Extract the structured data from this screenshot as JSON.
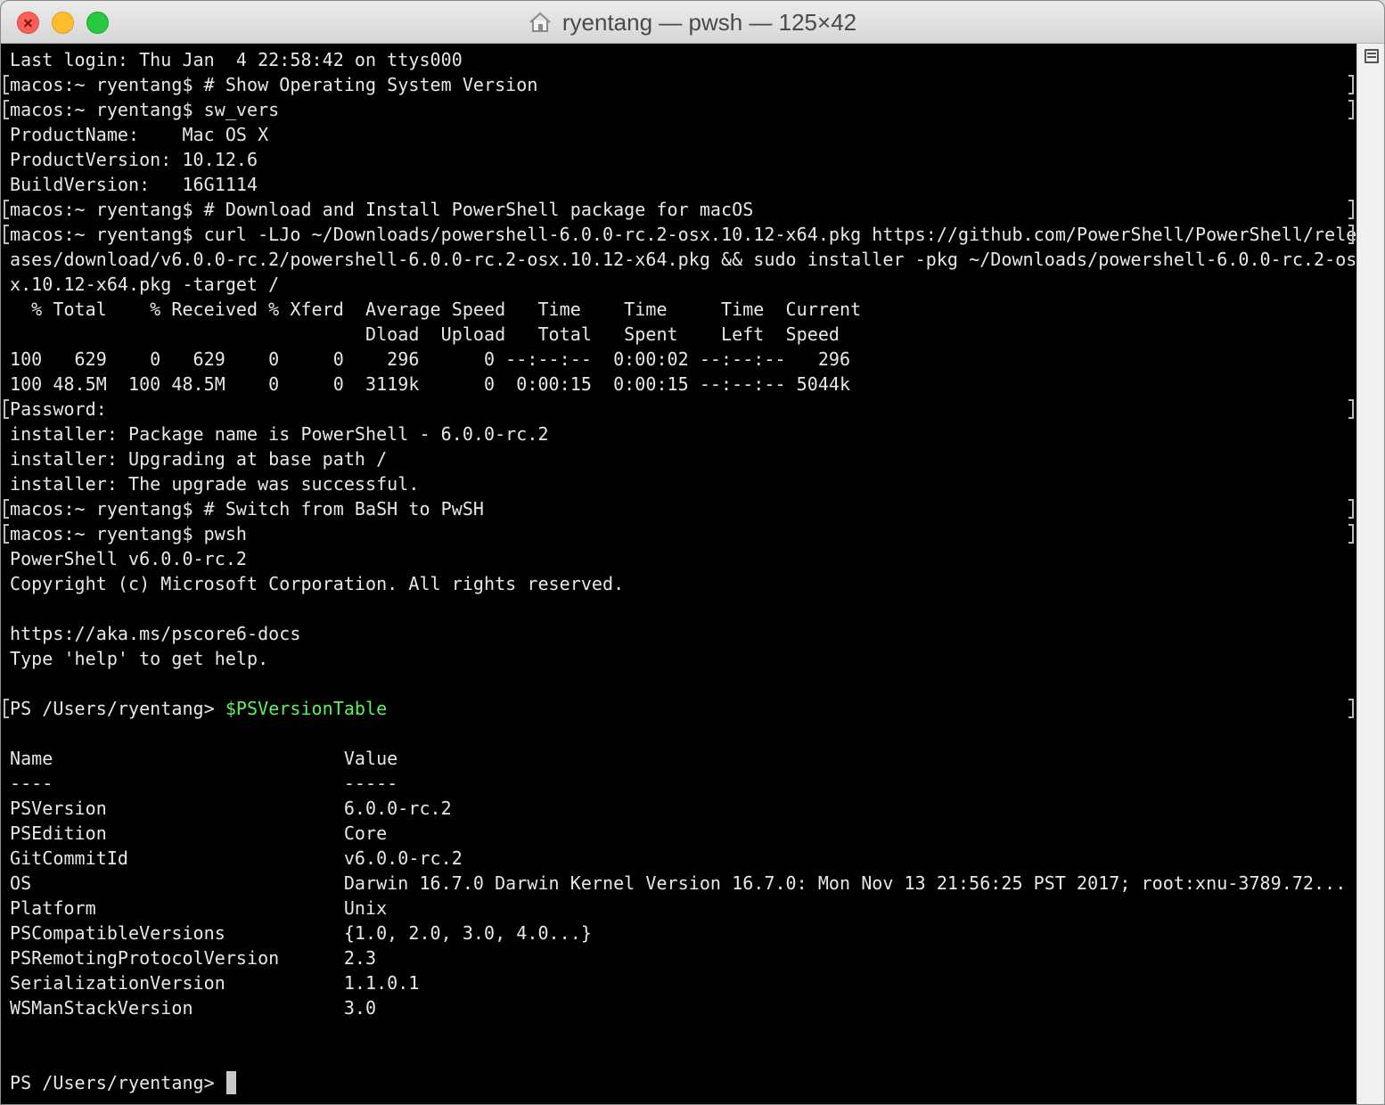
{
  "window": {
    "title": "ryentang — pwsh — 125×42"
  },
  "colors": {
    "background": "#000000",
    "text": "#e8e8e8",
    "command_highlight": "#5ff25f",
    "close": "#fc5f57",
    "minimize": "#fdbc2e",
    "zoom": "#28c840"
  },
  "icons": {
    "title": "home-icon",
    "scrollbar": "list-icon"
  },
  "terminal": {
    "lines": [
      {
        "text": "Last login: Thu Jan  4 22:58:42 on ttys000"
      },
      {
        "text": "macos:~ ryentang$ # Show Operating System Version",
        "mark": true
      },
      {
        "text": "macos:~ ryentang$ sw_vers",
        "mark": true
      },
      {
        "text": "ProductName:    Mac OS X"
      },
      {
        "text": "ProductVersion: 10.12.6"
      },
      {
        "text": "BuildVersion:   16G1114"
      },
      {
        "text": "macos:~ ryentang$ # Download and Install PowerShell package for macOS",
        "mark": true
      },
      {
        "text": "macos:~ ryentang$ curl -LJo ~/Downloads/powershell-6.0.0-rc.2-osx.10.12-x64.pkg https://github.com/PowerShell/PowerShell/rele",
        "mark": true
      },
      {
        "text": "ases/download/v6.0.0-rc.2/powershell-6.0.0-rc.2-osx.10.12-x64.pkg && sudo installer -pkg ~/Downloads/powershell-6.0.0-rc.2-os"
      },
      {
        "text": "x.10.12-x64.pkg -target /"
      },
      {
        "text": "  % Total    % Received % Xferd  Average Speed   Time    Time     Time  Current"
      },
      {
        "text": "                                 Dload  Upload   Total   Spent    Left  Speed"
      },
      {
        "text": "100   629    0   629    0     0    296      0 --:--:--  0:00:02 --:--:--   296"
      },
      {
        "text": "100 48.5M  100 48.5M    0     0  3119k      0  0:00:15  0:00:15 --:--:-- 5044k"
      },
      {
        "text": "Password:",
        "mark": true
      },
      {
        "text": "installer: Package name is PowerShell - 6.0.0-rc.2"
      },
      {
        "text": "installer: Upgrading at base path /"
      },
      {
        "text": "installer: The upgrade was successful."
      },
      {
        "text": "macos:~ ryentang$ # Switch from BaSH to PwSH",
        "mark": true
      },
      {
        "text": "macos:~ ryentang$ pwsh",
        "mark": true
      },
      {
        "text": "PowerShell v6.0.0-rc.2"
      },
      {
        "text": "Copyright (c) Microsoft Corporation. All rights reserved."
      },
      {
        "text": ""
      },
      {
        "text": "https://aka.ms/pscore6-docs"
      },
      {
        "text": "Type 'help' to get help."
      },
      {
        "text": ""
      },
      {
        "text": "PS /Users/ryentang> ",
        "highlight": "$PSVersionTable",
        "mark": true
      },
      {
        "text": ""
      },
      {
        "text": "Name                           Value"
      },
      {
        "text": "----                           -----"
      },
      {
        "text": "PSVersion                      6.0.0-rc.2"
      },
      {
        "text": "PSEdition                      Core"
      },
      {
        "text": "GitCommitId                    v6.0.0-rc.2"
      },
      {
        "text": "OS                             Darwin 16.7.0 Darwin Kernel Version 16.7.0: Mon Nov 13 21:56:25 PST 2017; root:xnu-3789.72..."
      },
      {
        "text": "Platform                       Unix"
      },
      {
        "text": "PSCompatibleVersions           {1.0, 2.0, 3.0, 4.0...}"
      },
      {
        "text": "PSRemotingProtocolVersion      2.3"
      },
      {
        "text": "SerializationVersion           1.1.0.1"
      },
      {
        "text": "WSManStackVersion              3.0"
      },
      {
        "text": ""
      },
      {
        "text": ""
      },
      {
        "text": "PS /Users/ryentang> ",
        "cursor": true
      }
    ]
  }
}
